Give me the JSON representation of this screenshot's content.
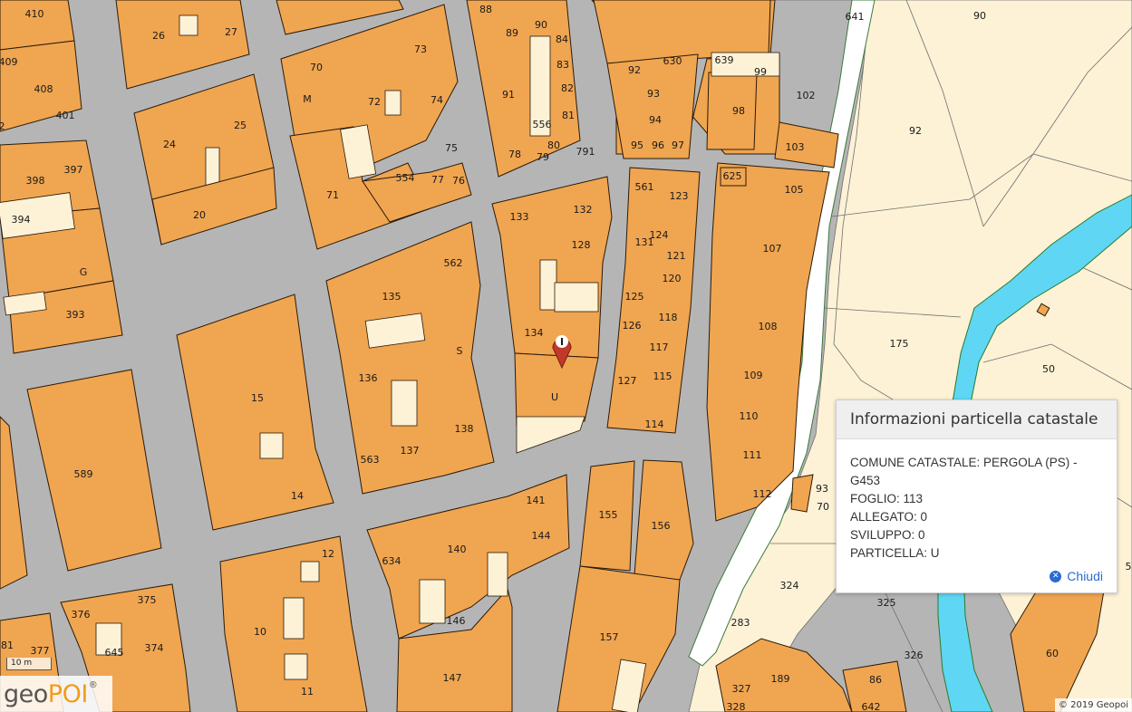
{
  "map": {
    "parcel_labels": [
      "410",
      "26",
      "27",
      "88",
      "89",
      "90",
      "84",
      "83",
      "82",
      "81",
      "556",
      "80",
      "791",
      "79",
      "78",
      "91",
      "641",
      "90",
      "409",
      "408",
      "401",
      "70",
      "M",
      "72",
      "73",
      "74",
      "75",
      "76",
      "77",
      "554",
      "71",
      "24",
      "25",
      "20",
      "92",
      "630",
      "639",
      "99",
      "102",
      "93",
      "94",
      "95",
      "96",
      "97",
      "98",
      "92",
      "103",
      "2",
      "398",
      "397",
      "394",
      "G",
      "393",
      "133",
      "132",
      "128",
      "134",
      "U",
      "561",
      "123",
      "124",
      "131",
      "121",
      "120",
      "125",
      "118",
      "126",
      "117",
      "127",
      "115",
      "114",
      "625",
      "105",
      "107",
      "108",
      "109",
      "110",
      "111",
      "112",
      "93",
      "70",
      "175",
      "50",
      "562",
      "135",
      "S",
      "136",
      "138",
      "137",
      "563",
      "15",
      "14",
      "589",
      "141",
      "144",
      "140",
      "634",
      "146",
      "147",
      "155",
      "156",
      "157",
      "12",
      "10",
      "11",
      "375",
      "376",
      "645",
      "374",
      "377",
      "81",
      "324",
      "325",
      "326",
      "283",
      "189",
      "327",
      "328",
      "86",
      "642",
      "60",
      "5"
    ],
    "marker_letter": "I",
    "river_color": "#5fd6f3",
    "parcel_color": "#f0a550",
    "yard_color": "#fdf2d6",
    "road_color": "#b5b5b5"
  },
  "popup": {
    "title": "Informazioni particella catastale",
    "lines": [
      "COMUNE CATASTALE: PERGOLA (PS) - G453",
      "FOGLIO: 113",
      "ALLEGATO: 0",
      "SVILUPPO: 0",
      "PARTICELLA: U"
    ],
    "close_icon": "close-circle-icon",
    "close_label": "Chiudi"
  },
  "branding": {
    "logo_prefix": "geo",
    "logo_accent": "POI",
    "logo_reg": "®",
    "accent_color": "#f39b1c"
  },
  "scale": {
    "label": "10 m"
  },
  "copyright": "© 2019 Geopoi"
}
